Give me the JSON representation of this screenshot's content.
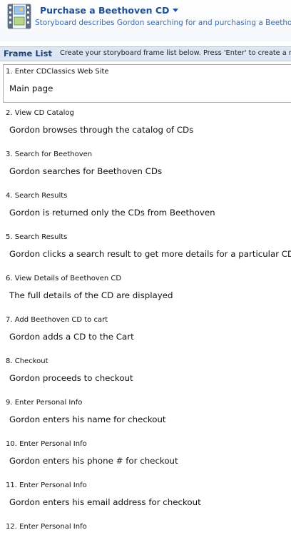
{
  "header": {
    "title": "Purchase a Beethoven CD",
    "subtitle": "Storyboard describes Gordon searching for and purchasing a Beethoven CD"
  },
  "frame_list": {
    "title": "Frame List",
    "hint": "Create your storyboard frame list below. Press 'Enter' to create a new frame."
  },
  "frames": [
    {
      "title": "1. Enter CDClassics Web Site",
      "description": "Main page"
    },
    {
      "title": "2. View CD Catalog",
      "description": "Gordon browses through the catalog of CDs"
    },
    {
      "title": "3. Search for Beethoven",
      "description": "Gordon searches for Beethoven CDs"
    },
    {
      "title": "4. Search Results",
      "description": "Gordon is returned only the CDs from Beethoven"
    },
    {
      "title": "5. Search Results",
      "description": "Gordon clicks a search result to get more details for a particular CD"
    },
    {
      "title": "6. View Details of Beethoven CD",
      "description": "The full details of the CD are displayed"
    },
    {
      "title": "7. Add Beethoven CD to cart",
      "description": "Gordon adds a CD to the Cart"
    },
    {
      "title": "8. Checkout",
      "description": "Gordon proceeds to checkout"
    },
    {
      "title": "9. Enter Personal Info",
      "description": "Gordon enters his name for checkout"
    },
    {
      "title": "10. Enter Personal Info",
      "description": "Gordon enters his phone # for checkout"
    },
    {
      "title": "11. Enter Personal Info",
      "description": "Gordon enters his email address for checkout"
    },
    {
      "title": "12. Enter Personal Info",
      "description": ""
    }
  ],
  "colors": {
    "title": "#1f4f96",
    "subtitle": "#3a6cb5",
    "bar_bg": "#dde7f4",
    "bar_title": "#1e3f73"
  },
  "icons": {
    "document": "storyboard-film-icon",
    "menu": "chevron-down-icon"
  }
}
